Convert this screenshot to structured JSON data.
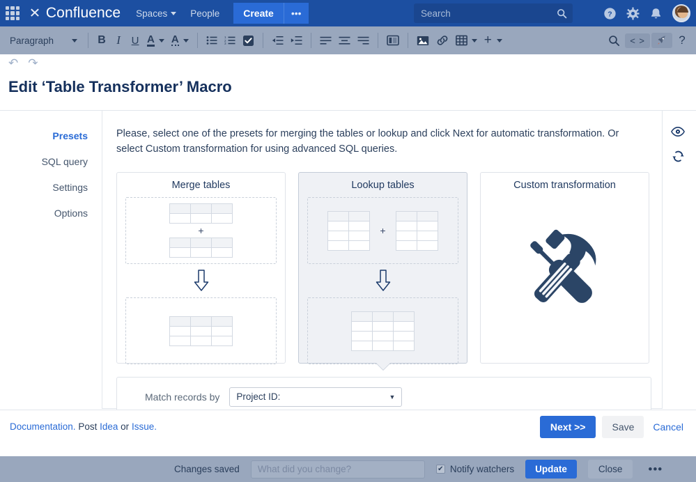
{
  "topnav": {
    "apps_icon": "apps-grid-icon",
    "brand": "Confluence",
    "brand_mark": "✕",
    "spaces": "Spaces",
    "people": "People",
    "create": "Create",
    "more": "•••",
    "search_placeholder": "Search",
    "icons": [
      "help-icon",
      "settings-gear-icon",
      "notifications-bell-icon",
      "user-avatar"
    ]
  },
  "toolbar": {
    "paragraph_label": "Paragraph",
    "bold": "B",
    "italic": "I",
    "underline": "U",
    "text_color": "A",
    "highlight": "A",
    "bullet_list": "bullet-list-icon",
    "numbered_list": "numbered-list-icon",
    "task_list": "task-list-icon",
    "outdent": "outdent-icon",
    "indent": "indent-icon",
    "align_left": "align-left-icon",
    "align_center": "align-center-icon",
    "align_right": "align-right-icon",
    "layout": "page-layout-icon",
    "image": "insert-image-icon",
    "link": "insert-link-icon",
    "table": "insert-table-icon",
    "plus": "+",
    "find": "find-replace-icon",
    "markup": "< >",
    "shortcut": "rocket-icon",
    "help": "?"
  },
  "undo_row": {
    "undo": "↶",
    "redo": "↷"
  },
  "dialog": {
    "title": "Edit ‘Table Transformer’ Macro",
    "side_tabs": [
      {
        "label": "Presets",
        "active": true
      },
      {
        "label": "SQL query",
        "active": false
      },
      {
        "label": "Settings",
        "active": false
      },
      {
        "label": "Options",
        "active": false
      }
    ],
    "intro": "Please, select one of the presets for merging the tables or lookup and click Next for automatic transformation. Or select Custom transformation for using advanced SQL queries.",
    "cards": [
      {
        "title": "Merge tables",
        "selected": false,
        "layout": "stacked",
        "plus": "+",
        "arrow": "⇩"
      },
      {
        "title": "Lookup tables",
        "selected": true,
        "layout": "side-by-side",
        "plus": "+",
        "arrow": "⇩"
      },
      {
        "title": "Custom transformation",
        "selected": false,
        "layout": "icon",
        "icon": "hammer-and-screwdriver-icon"
      }
    ],
    "match": {
      "label": "Match records by",
      "selected_value": "Project ID:",
      "caret": "▼"
    },
    "rail": [
      {
        "name": "preview-eye-icon"
      },
      {
        "name": "refresh-sync-icon"
      }
    ],
    "footer": {
      "documentation_link": "Documentation.",
      "post_text": "Post",
      "idea_link": "Idea",
      "or_text": "or",
      "issue_link": "Issue.",
      "next_button": "Next >>",
      "save_button": "Save",
      "cancel_button": "Cancel"
    }
  },
  "bottombar": {
    "status": "Changes saved",
    "change_placeholder": "What did you change?",
    "notify_label": "Notify watchers",
    "notify_checked": true,
    "check_glyph": "✔",
    "update_button": "Update",
    "close_button": "Close",
    "more_button": "•••"
  },
  "colors": {
    "nav_blue": "#1c4fa1",
    "accent_blue": "#2a6bd6",
    "toolbar_gray": "#99a7bd",
    "selected_card": "#eff1f5",
    "icon_navy": "#2b4566"
  }
}
